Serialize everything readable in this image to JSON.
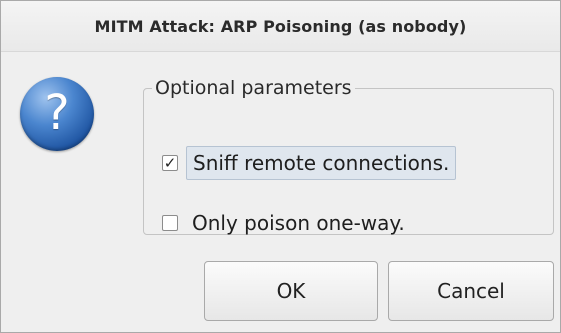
{
  "dialog": {
    "title": "MITM Attack: ARP Poisoning (as nobody)",
    "icon": "question-icon",
    "icon_glyph": "?",
    "accent_color": "#2a65b5"
  },
  "parameters": {
    "legend": "Optional parameters",
    "options": [
      {
        "label": "Sniff remote connections.",
        "checked": true,
        "check_glyph": "✓"
      },
      {
        "label": "Only poison one-way.",
        "checked": false,
        "check_glyph": ""
      }
    ]
  },
  "buttons": {
    "ok_label": "OK",
    "cancel_label": "Cancel"
  }
}
